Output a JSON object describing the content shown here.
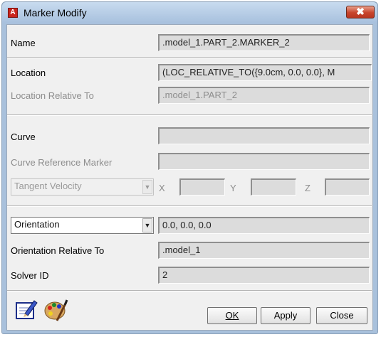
{
  "window": {
    "title": "Marker Modify",
    "close_glyph": "✖"
  },
  "fields": {
    "name_label": "Name",
    "name_value": ".model_1.PART_2.MARKER_2",
    "location_label": "Location",
    "location_value": "(LOC_RELATIVE_TO({9.0cm, 0.0, 0.0}, M",
    "location_rel_label": "Location Relative To",
    "location_rel_value": ".model_1.PART_2",
    "curve_label": "Curve",
    "curve_value": "",
    "curve_ref_label": "Curve Reference Marker",
    "curve_ref_value": "",
    "tangent_combo": "Tangent Velocity",
    "x_label": "X",
    "y_label": "Y",
    "z_label": "Z",
    "orientation_combo": "Orientation",
    "orientation_value": "0.0, 0.0, 0.0",
    "orientation_rel_label": "Orientation Relative To",
    "orientation_rel_value": ".model_1",
    "solver_label": "Solver ID",
    "solver_value": "2"
  },
  "buttons": {
    "ok": "OK",
    "apply": "Apply",
    "close": "Close"
  },
  "icons": {
    "edit": "edit-icon",
    "appearance": "appearance-palette-icon"
  },
  "colors": {
    "title_gradient_top": "#c8dbef",
    "close_red": "#c8452c",
    "field_bg": "#dcdcdc"
  }
}
